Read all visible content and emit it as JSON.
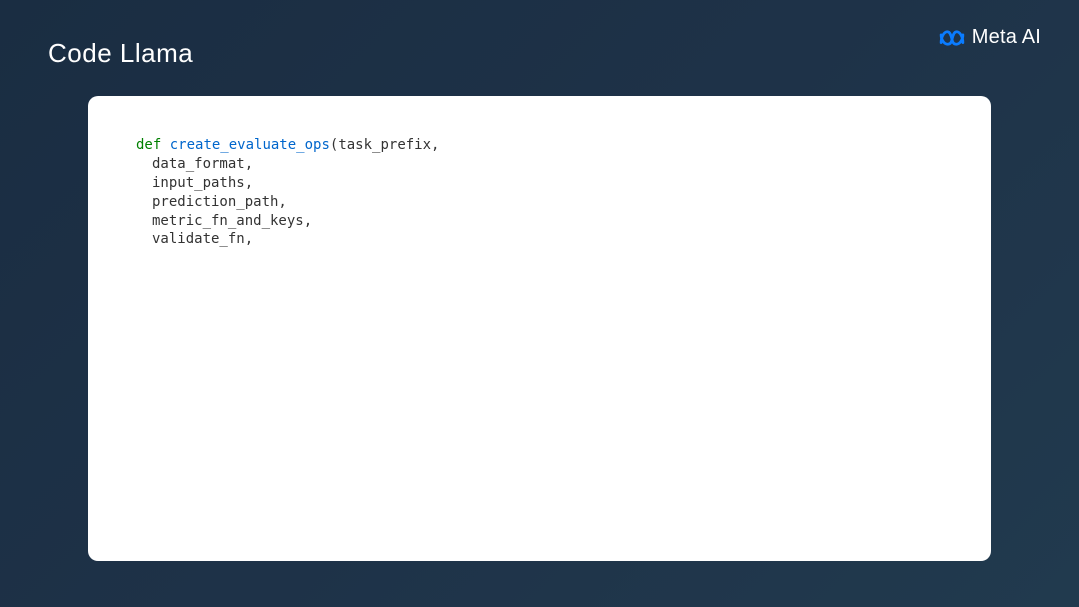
{
  "header": {
    "title": "Code Llama"
  },
  "logo": {
    "brand_text": "Meta AI",
    "icon_name": "meta-infinity-icon"
  },
  "code": {
    "kw_def": "def",
    "fn_name": "create_evaluate_ops",
    "paren_open": "(",
    "param0": "task_prefix,",
    "param1": "data_format,",
    "param2": "input_paths,",
    "param3": "prediction_path,",
    "param4": "metric_fn_and_keys,",
    "param5": "validate_fn,"
  }
}
